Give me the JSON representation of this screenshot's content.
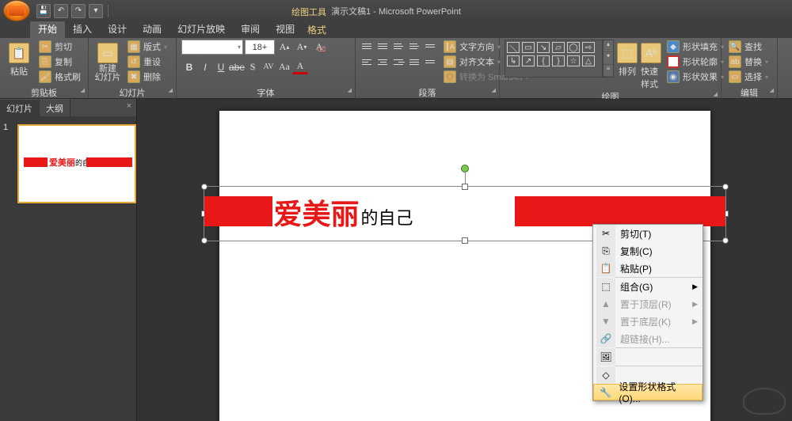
{
  "title": {
    "doc": "演示文稿1",
    "app": "Microsoft PowerPoint",
    "sep": " - ",
    "context_tool": "绘图工具"
  },
  "tabs": {
    "home": "开始",
    "insert": "插入",
    "design": "设计",
    "anim": "动画",
    "slideshow": "幻灯片放映",
    "review": "审阅",
    "view": "视图",
    "format": "格式"
  },
  "ribbon": {
    "clipboard": {
      "label": "剪贴板",
      "paste": "粘贴",
      "cut": "剪切",
      "copy": "复制",
      "painter": "格式刷"
    },
    "slides": {
      "label": "幻灯片",
      "new": "新建\n幻灯片",
      "layout": "版式",
      "reset": "重设",
      "delete": "删除"
    },
    "font": {
      "label": "字体",
      "size": "18+"
    },
    "paragraph": {
      "label": "段落",
      "dir": "文字方向",
      "align": "对齐文本",
      "smartart": "转换为 SmartArt"
    },
    "drawing": {
      "label": "绘图",
      "arrange": "排列",
      "quick": "快速样式",
      "fill": "形状填充",
      "outline": "形状轮廓",
      "effects": "形状效果"
    },
    "editing": {
      "label": "编辑",
      "find": "查找",
      "replace": "替换",
      "select": "选择"
    }
  },
  "side": {
    "slides": "幻灯片",
    "outline": "大纲",
    "num": "1"
  },
  "slide_text": {
    "red": "爱美丽",
    "black": "的自己"
  },
  "context_menu": {
    "cut": "剪切(T)",
    "copy": "复制(C)",
    "paste": "粘贴(P)",
    "group": "组合(G)",
    "front": "置于顶层(R)",
    "back": "置于底层(K)",
    "hyperlink": "超链接(H)...",
    "saveimg": "",
    "default": "",
    "format": "设置形状格式(O)..."
  }
}
